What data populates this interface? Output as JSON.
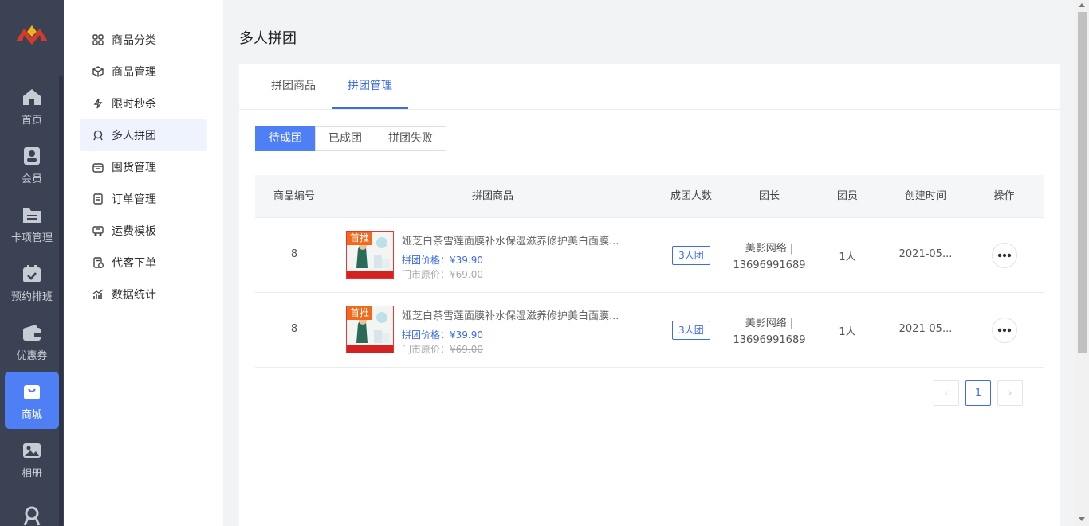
{
  "leftnav": {
    "items": [
      {
        "label": "首页",
        "icon": "home-icon"
      },
      {
        "label": "会员",
        "icon": "member-icon"
      },
      {
        "label": "卡项管理",
        "icon": "card-folder-icon"
      },
      {
        "label": "预约排班",
        "icon": "calendar-icon"
      },
      {
        "label": "优惠券",
        "icon": "wallet-icon"
      },
      {
        "label": "商城",
        "icon": "shopping-bag-icon",
        "active": true
      },
      {
        "label": "相册",
        "icon": "album-icon"
      }
    ]
  },
  "submenu": {
    "items": [
      {
        "label": "商品分类",
        "icon": "grid-icon"
      },
      {
        "label": "商品管理",
        "icon": "box-icon"
      },
      {
        "label": "限时秒杀",
        "icon": "flash-icon"
      },
      {
        "label": "多人拼团",
        "icon": "group-icon",
        "active": true
      },
      {
        "label": "囤货管理",
        "icon": "store-icon"
      },
      {
        "label": "订单管理",
        "icon": "order-icon"
      },
      {
        "label": "运费模板",
        "icon": "truck-icon"
      },
      {
        "label": "代客下单",
        "icon": "proxy-order-icon"
      },
      {
        "label": "数据统计",
        "icon": "chart-icon"
      }
    ]
  },
  "page": {
    "title": "多人拼团",
    "tabs": [
      {
        "label": "拼团商品"
      },
      {
        "label": "拼团管理",
        "active": true
      }
    ],
    "segments": [
      {
        "label": "待成团",
        "active": true
      },
      {
        "label": "已成团"
      },
      {
        "label": "拼团失败"
      }
    ]
  },
  "table": {
    "headers": [
      "商品编号",
      "拼团商品",
      "成团人数",
      "团长",
      "团员",
      "创建时间",
      "操作"
    ],
    "rows": [
      {
        "id": "8",
        "badge": "首推",
        "name": "娅芝白茶雪莲面膜补水保湿滋养修护美白面膜...",
        "price": "拼团价格：¥39.90",
        "orig_label": "门市原价：",
        "orig_value": "¥69.00",
        "size": "3人团",
        "leader_name": "美影网络 |",
        "leader_phone": "13696991689",
        "members": "1人",
        "created": "2021-05..."
      },
      {
        "id": "8",
        "badge": "首推",
        "name": "娅芝白茶雪莲面膜补水保湿滋养修护美白面膜...",
        "price": "拼团价格：¥39.90",
        "orig_label": "门市原价：",
        "orig_value": "¥69.00",
        "size": "3人团",
        "leader_name": "美影网络 |",
        "leader_phone": "13696991689",
        "members": "1人",
        "created": "2021-05..."
      }
    ]
  },
  "pagination": {
    "current": "1",
    "prev": "‹",
    "next": "›"
  },
  "colors": {
    "accent": "#4f7ff5",
    "nav_bg": "#3b4254",
    "link": "#3d6ce7"
  }
}
